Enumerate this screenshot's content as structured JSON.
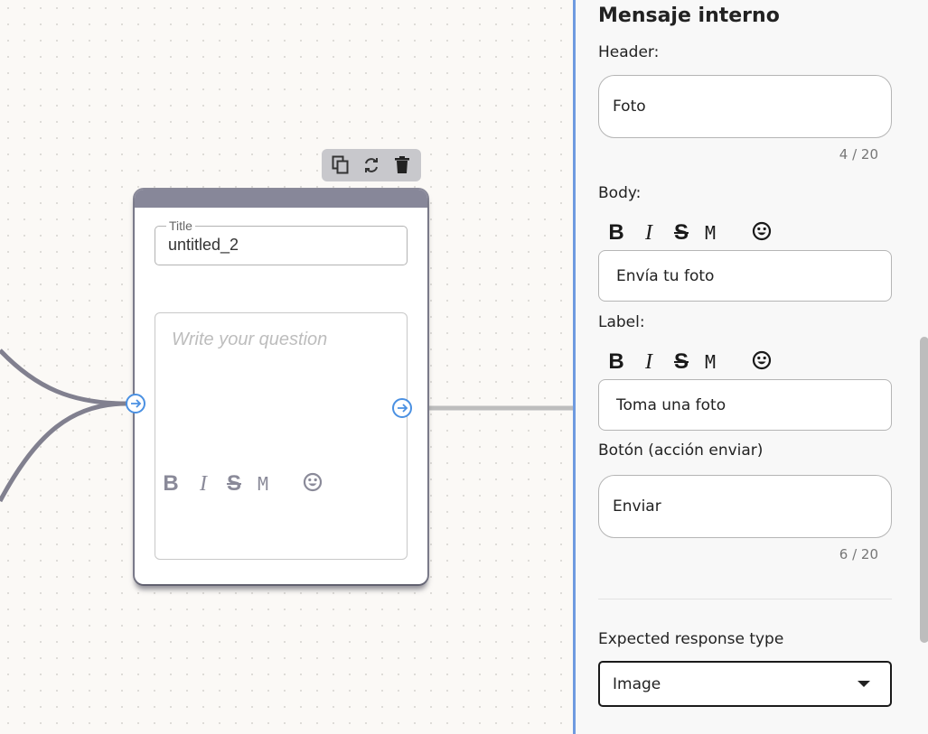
{
  "node": {
    "title_legend": "Title",
    "title_value": "untitled_2",
    "question_placeholder": "Write your question",
    "format": {
      "bold": "B",
      "italic": "I",
      "strike": "S",
      "mono": "M"
    }
  },
  "panel": {
    "title": "Mensaje interno",
    "header_label": "Header:",
    "header_value": "Foto",
    "header_counter": "4 / 20",
    "body_label": "Body:",
    "body_value": "Envía tu foto",
    "label_label": "Label:",
    "label_value": "Toma una foto",
    "button_label": "Botón (acción enviar)",
    "button_value": "Enviar",
    "button_counter": "6 / 20",
    "response_type_label": "Expected response type",
    "response_type_value": "Image",
    "format": {
      "bold": "B",
      "italic": "I",
      "strike": "S",
      "mono": "M"
    }
  },
  "icons": {
    "toolbar": [
      "copy-icon",
      "refresh-icon",
      "trash-icon"
    ],
    "emoji": "emoji-icon",
    "handle": "arrow-right-circle-icon",
    "dropdown": "caret-down-icon"
  },
  "colors": {
    "accent": "#4a90e2",
    "node_header": "#878799",
    "panel_border": "#6f9be0"
  }
}
